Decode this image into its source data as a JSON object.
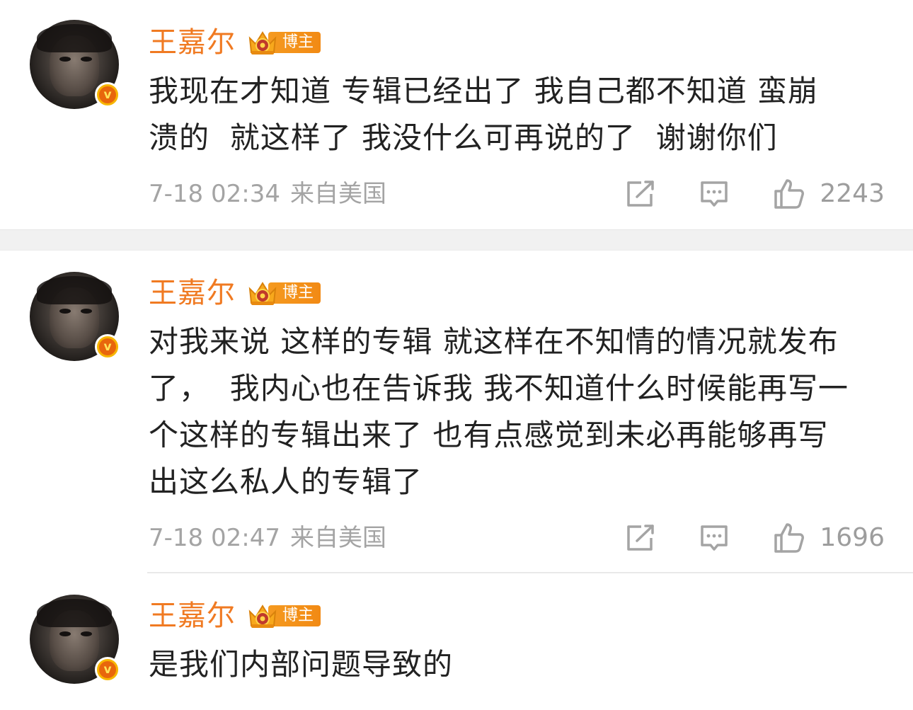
{
  "comments": [
    {
      "user": "王嘉尔",
      "badge": "博主",
      "text": "我现在才知道 专辑已经出了 我自己都不知道 蛮崩\n溃的  就这样了 我没什么可再说的了  谢谢你们",
      "time": "7-18 02:34",
      "location": "来自美国",
      "likes": "2243"
    },
    {
      "user": "王嘉尔",
      "badge": "博主",
      "text": "对我来说 这样的专辑 就这样在不知情的情况就发布\n了，  我内心也在告诉我 我不知道什么时候能再写一\n个这样的专辑出来了 也有点感觉到未必再能够再写\n出这么私人的专辑了",
      "time": "7-18 02:47",
      "location": "来自美国",
      "likes": "1696"
    },
    {
      "user": "王嘉尔",
      "badge": "博主",
      "text": "是我们内部问题导致的"
    }
  ],
  "colors": {
    "username": "#f07a22",
    "badge": "#f59a20",
    "meta": "#a4a4a4",
    "text": "#222222"
  },
  "icons": {
    "verified": "verified-v-icon",
    "crown": "crown-icon",
    "repost": "repost-icon",
    "comment": "comment-icon",
    "like": "thumbs-up-icon"
  }
}
